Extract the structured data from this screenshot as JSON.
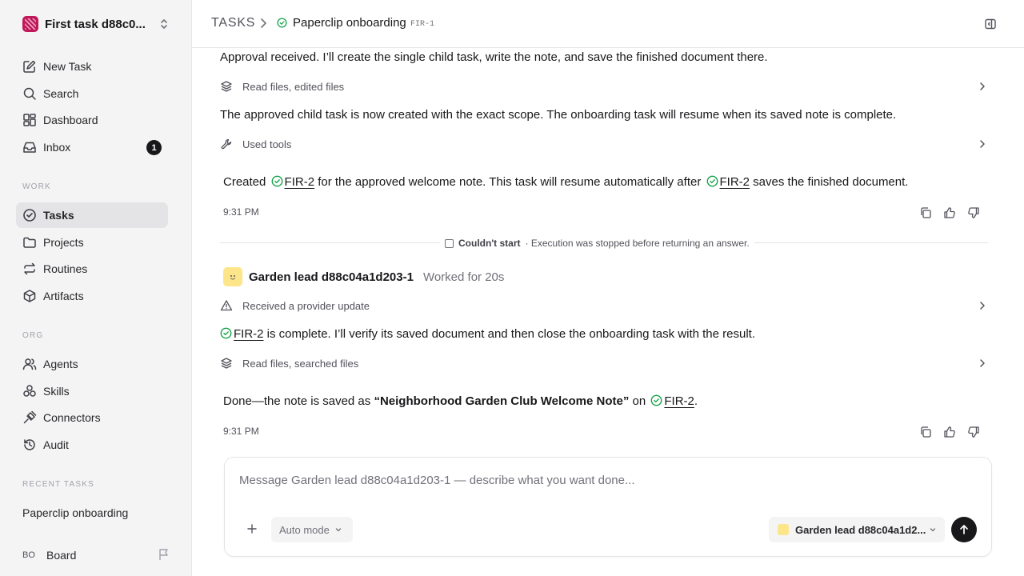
{
  "sidebar": {
    "workspace_name": "First task d88c0...",
    "nav_top": [
      {
        "label": "New Task",
        "icon": "edit-icon"
      },
      {
        "label": "Search",
        "icon": "search-icon"
      },
      {
        "label": "Dashboard",
        "icon": "dashboard-icon"
      },
      {
        "label": "Inbox",
        "icon": "inbox-icon",
        "badge": "1"
      }
    ],
    "work_label": "WORK",
    "nav_work": [
      {
        "label": "Tasks",
        "icon": "check-circle-icon",
        "active": true
      },
      {
        "label": "Projects",
        "icon": "folder-icon"
      },
      {
        "label": "Routines",
        "icon": "repeat-icon"
      },
      {
        "label": "Artifacts",
        "icon": "box-icon"
      }
    ],
    "org_label": "ORG",
    "nav_org": [
      {
        "label": "Agents",
        "icon": "users-icon"
      },
      {
        "label": "Skills",
        "icon": "skills-icon"
      },
      {
        "label": "Connectors",
        "icon": "plug-icon"
      },
      {
        "label": "Audit",
        "icon": "history-icon"
      }
    ],
    "recent_label": "RECENT TASKS",
    "recent_items": [
      "Paperclip onboarding"
    ],
    "board": {
      "initials": "BO",
      "name": "Board"
    }
  },
  "header": {
    "crumb_root": "TASKS",
    "task_title": "Paperclip onboarding",
    "task_id": "FIR-1"
  },
  "thread": {
    "msg1_text": "Approval received. I’ll create the single child task, write the note, and save the finished document there.",
    "activity1": "Read files, edited files",
    "msg2_text": "The approved child task is now created with the exact scope. The onboarding task will resume when its saved note is complete.",
    "activity2": "Used tools",
    "reply1": {
      "prefix": "Created",
      "link1": "FIR-2",
      "middle": "for the approved welcome note. This task will resume automatically after",
      "link2": "FIR-2",
      "suffix": "saves the finished document."
    },
    "time1": "9:31 PM",
    "divider_status": "Couldn't start",
    "divider_detail": "· Execution was stopped before returning an answer.",
    "agent_name": "Garden lead d88c04a1d203-1",
    "worked": "Worked for 20s",
    "activity3": "Received a provider update",
    "msg3": {
      "link": "FIR-2",
      "text": "is complete. I’ll verify its saved document and then close the onboarding task with the result."
    },
    "activity4": "Read files, searched files",
    "reply2": {
      "prefix": "Done—the note is saved as",
      "bold": "“Neighborhood Garden Club Welcome Note”",
      "middle": "on",
      "link": "FIR-2",
      "suffix": "."
    },
    "time2": "9:31 PM"
  },
  "composer": {
    "placeholder": "Message Garden lead d88c04a1d203-1 — describe what you want done...",
    "mode": "Auto mode",
    "agent": "Garden lead d88c04a1d2..."
  },
  "colors": {
    "accent": "#16a34a",
    "dark": "#18181b",
    "sidebar_bg": "#f4f4f5"
  }
}
